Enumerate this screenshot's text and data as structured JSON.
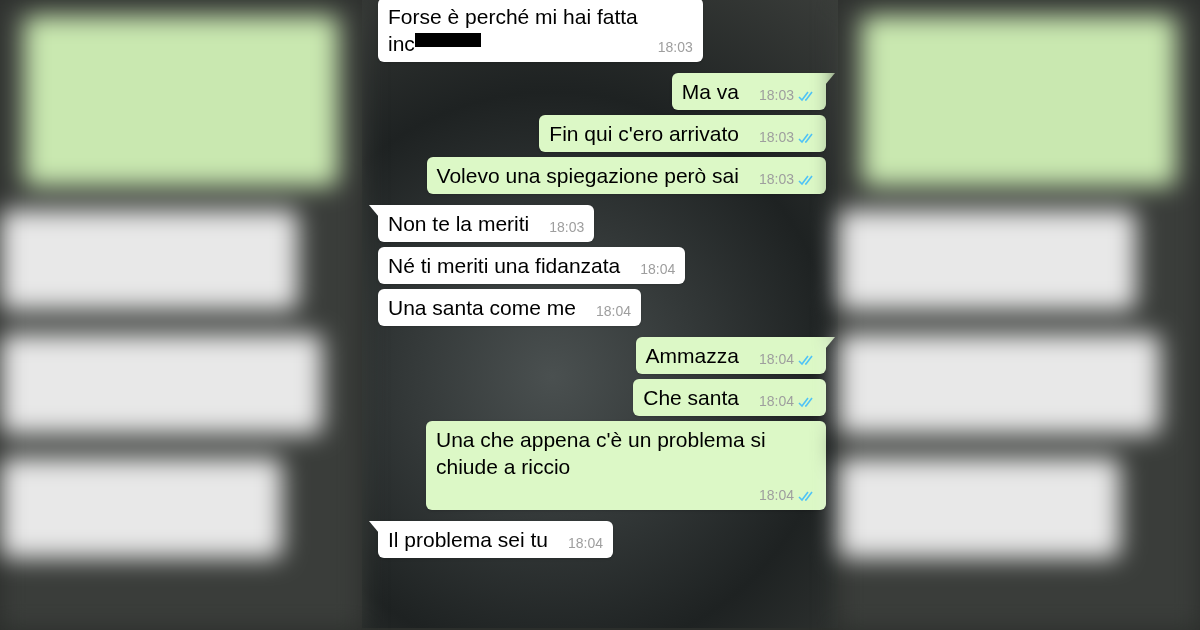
{
  "messages": [
    {
      "kind": "incoming",
      "text": "Forse è perché mi hai fatta\ninc",
      "redacted": true,
      "time": "18:03"
    },
    {
      "kind": "outgoing",
      "text": "Ma va",
      "time": "18:03",
      "read": true
    },
    {
      "kind": "outgoing",
      "text": "Fin qui c'ero arrivato",
      "time": "18:03",
      "read": true
    },
    {
      "kind": "outgoing",
      "text": "Volevo una spiegazione però sai",
      "time": "18:03",
      "read": true
    },
    {
      "kind": "incoming",
      "text": "Non te la meriti",
      "time": "18:03"
    },
    {
      "kind": "incoming",
      "text": "Né ti meriti una fidanzata",
      "time": "18:04"
    },
    {
      "kind": "incoming",
      "text": "Una santa come me",
      "time": "18:04"
    },
    {
      "kind": "outgoing",
      "text": "Ammazza",
      "time": "18:04",
      "read": true
    },
    {
      "kind": "outgoing",
      "text": "Che santa",
      "time": "18:04",
      "read": true
    },
    {
      "kind": "outgoing",
      "text": "Una che appena c'è un problema si\nchiude a riccio",
      "time": "18:04",
      "read": true
    },
    {
      "kind": "incoming",
      "text": "Il problema sei tu",
      "time": "18:04"
    }
  ]
}
